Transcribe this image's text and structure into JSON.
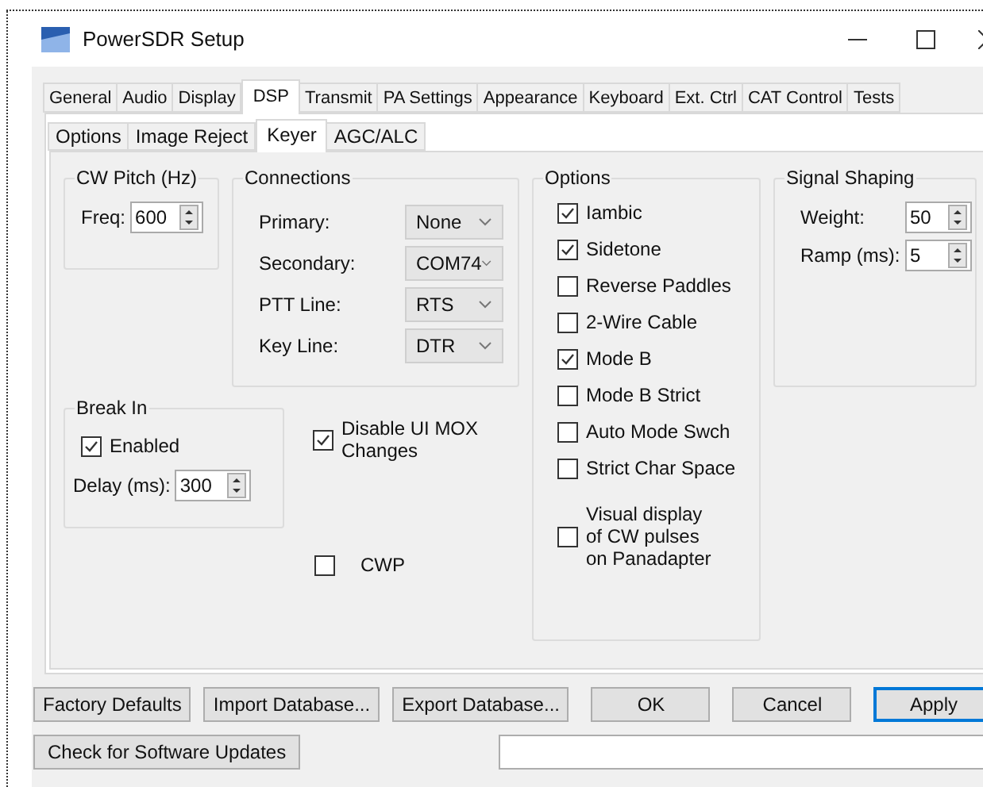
{
  "window": {
    "title": "PowerSDR Setup"
  },
  "tabs": [
    {
      "label": "General",
      "selected": false
    },
    {
      "label": "Audio",
      "selected": false
    },
    {
      "label": "Display",
      "selected": false
    },
    {
      "label": "DSP",
      "selected": true
    },
    {
      "label": "Transmit",
      "selected": false
    },
    {
      "label": "PA Settings",
      "selected": false
    },
    {
      "label": "Appearance",
      "selected": false
    },
    {
      "label": "Keyboard",
      "selected": false
    },
    {
      "label": "Ext. Ctrl",
      "selected": false
    },
    {
      "label": "CAT Control",
      "selected": false
    },
    {
      "label": "Tests",
      "selected": false
    }
  ],
  "subtabs": [
    {
      "label": "Options",
      "selected": false
    },
    {
      "label": "Image Reject",
      "selected": false
    },
    {
      "label": "Keyer",
      "selected": true
    },
    {
      "label": "AGC/ALC",
      "selected": false
    }
  ],
  "cw_pitch": {
    "title": "CW Pitch (Hz)",
    "label": "Freq:",
    "value": "600"
  },
  "connections": {
    "title": "Connections",
    "rows": [
      {
        "label": "Primary:",
        "value": "None"
      },
      {
        "label": "Secondary:",
        "value": "COM74"
      },
      {
        "label": "PTT Line:",
        "value": "RTS"
      },
      {
        "label": "Key Line:",
        "value": "DTR"
      }
    ]
  },
  "break_in": {
    "title": "Break In",
    "enabled": {
      "label": "Enabled",
      "checked": true
    },
    "delay_label": "Delay (ms):",
    "delay_value": "300"
  },
  "disable_ui_mox": {
    "label": "Disable UI MOX\nChanges",
    "checked": true
  },
  "cwp": {
    "label": "CWP",
    "checked": false
  },
  "options": {
    "title": "Options",
    "items": [
      {
        "label": "Iambic",
        "checked": true
      },
      {
        "label": "Sidetone",
        "checked": true
      },
      {
        "label": "Reverse Paddles",
        "checked": false
      },
      {
        "label": "2-Wire Cable",
        "checked": false
      },
      {
        "label": "Mode B",
        "checked": true
      },
      {
        "label": "Mode B Strict",
        "checked": false
      },
      {
        "label": "Auto Mode Swch",
        "checked": false
      },
      {
        "label": "Strict Char Space",
        "checked": false
      },
      {
        "label": "Visual display\nof CW pulses\non Panadapter",
        "checked": false
      }
    ]
  },
  "signal_shaping": {
    "title": "Signal Shaping",
    "rows": [
      {
        "label": "Weight:",
        "value": "50"
      },
      {
        "label": "Ramp (ms):",
        "value": "5"
      }
    ]
  },
  "buttons": [
    {
      "label": "Factory Defaults",
      "focused": false
    },
    {
      "label": "Import Database...",
      "focused": false
    },
    {
      "label": "Export Database...",
      "focused": false
    },
    {
      "label": "OK",
      "focused": false
    },
    {
      "label": "Cancel",
      "focused": false
    },
    {
      "label": "Apply",
      "focused": true
    }
  ],
  "update_button": {
    "label": "Check for Software Updates"
  }
}
